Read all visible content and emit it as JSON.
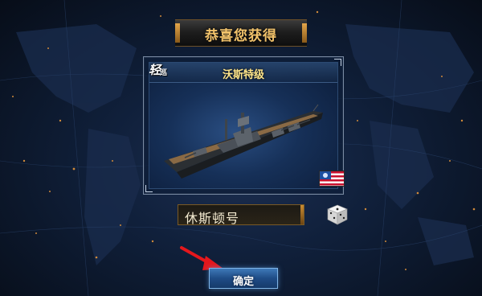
{
  "dialog": {
    "title": "恭喜您获得",
    "ship_card": {
      "class_badge_main": "轻",
      "class_badge_sub": "巡",
      "ship_class": "沃斯特级",
      "nation_flag": "usa-flag-icon"
    },
    "ship_name_value": "休斯顿号",
    "randomize_icon": "dice-icon",
    "confirm_label": "确定",
    "annotation_icon": "red-arrow-icon"
  },
  "colors": {
    "title_gold": "#f2c36b",
    "ship_class_yellow": "#ffe58a",
    "button_blue": "#1f4c86",
    "arrow_red": "#e5171c"
  }
}
